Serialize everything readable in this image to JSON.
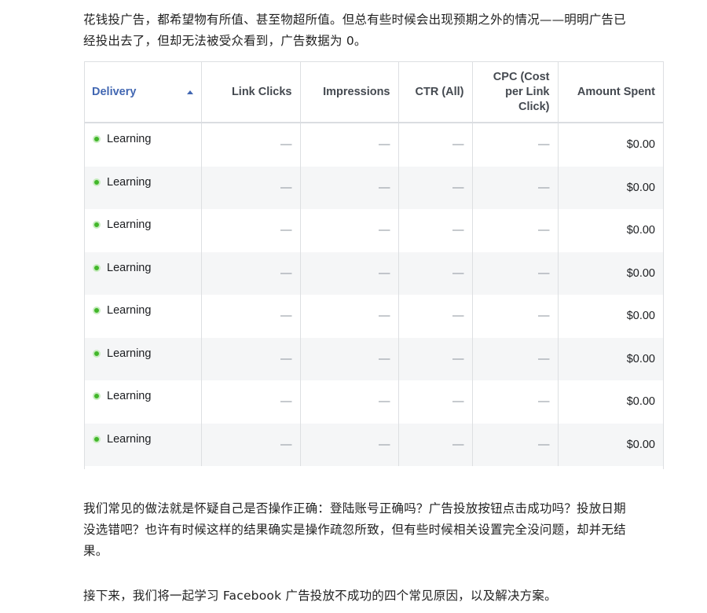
{
  "intro_text": "花钱投广告，都希望物有所值、甚至物超所值。但总有些时候会出现预期之外的情况——明明广告已经投出去了，但却无法被受众看到，广告数据为 0。",
  "table": {
    "columns": {
      "delivery": "Delivery",
      "link_clicks": "Link Clicks",
      "impressions": "Impressions",
      "ctr": "CTR (All)",
      "cpc": "CPC (Cost per Link Click)",
      "amount_spent": "Amount Spent"
    },
    "rows": [
      {
        "delivery": "Learning",
        "link_clicks": "—",
        "impressions": "—",
        "ctr": "—",
        "cpc": "—",
        "amount_spent": "$0.00"
      },
      {
        "delivery": "Learning",
        "link_clicks": "—",
        "impressions": "—",
        "ctr": "—",
        "cpc": "—",
        "amount_spent": "$0.00"
      },
      {
        "delivery": "Learning",
        "link_clicks": "—",
        "impressions": "—",
        "ctr": "—",
        "cpc": "—",
        "amount_spent": "$0.00"
      },
      {
        "delivery": "Learning",
        "link_clicks": "—",
        "impressions": "—",
        "ctr": "—",
        "cpc": "—",
        "amount_spent": "$0.00"
      },
      {
        "delivery": "Learning",
        "link_clicks": "—",
        "impressions": "—",
        "ctr": "—",
        "cpc": "—",
        "amount_spent": "$0.00"
      },
      {
        "delivery": "Learning",
        "link_clicks": "—",
        "impressions": "—",
        "ctr": "—",
        "cpc": "—",
        "amount_spent": "$0.00"
      },
      {
        "delivery": "Learning",
        "link_clicks": "—",
        "impressions": "—",
        "ctr": "—",
        "cpc": "—",
        "amount_spent": "$0.00"
      },
      {
        "delivery": "Learning",
        "link_clicks": "—",
        "impressions": "—",
        "ctr": "—",
        "cpc": "—",
        "amount_spent": "$0.00"
      }
    ]
  },
  "middle_text": "我们常见的做法就是怀疑自己是否操作正确：登陆账号正确吗？广告投放按钮点击成功吗？投放日期没选错吧？也许有时候这样的结果确实是操作疏忽所致，但有些时候相关设置完全没问题，却并无结果。",
  "next_text": "接下来，我们将一起学习 Facebook 广告投放不成功的四个常见原因，以及解决方案。",
  "colors": {
    "accent": "#4267b2",
    "status_learning": "#42b72a",
    "row_alt": "#f5f6f7"
  },
  "icons": {
    "sort": "sort-ascending-icon",
    "status": "status-dot-icon"
  }
}
